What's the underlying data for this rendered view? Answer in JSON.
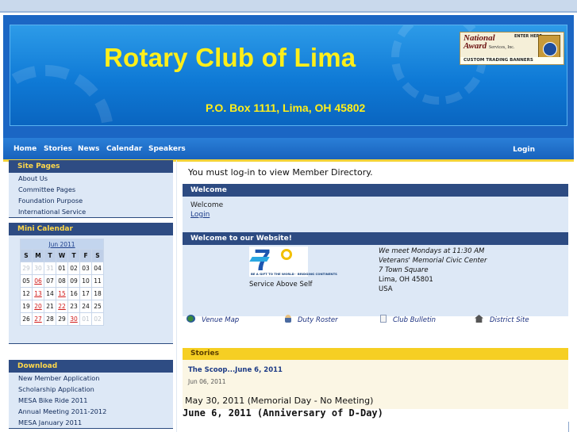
{
  "header": {
    "title": "Rotary Club of Lima",
    "address": "P.O. Box 1111, Lima, OH 45802",
    "ad": {
      "brand_line1": "National",
      "brand_line2": "Award",
      "brand_small": "Services, Inc.",
      "enter_here": "ENTER HERE",
      "footer": "CUSTOM TRADING BANNERS"
    }
  },
  "nav": {
    "items": [
      "Home",
      "Stories",
      "News",
      "Calendar",
      "Speakers"
    ],
    "login": "Login"
  },
  "sidebar": {
    "site_pages": {
      "title": "Site Pages",
      "items": [
        "About Us",
        "Committee Pages",
        "Foundation Purpose",
        "International Service"
      ]
    },
    "mini_calendar": {
      "title": "Mini Calendar",
      "month": "Jun 2011",
      "weekdays": [
        "S",
        "M",
        "T",
        "W",
        "T",
        "F",
        "S"
      ],
      "weeks": [
        [
          "29",
          "30",
          "31",
          "01",
          "02",
          "03",
          "04"
        ],
        [
          "05",
          "06",
          "07",
          "08",
          "09",
          "10",
          "11"
        ],
        [
          "12",
          "13",
          "14",
          "15",
          "16",
          "17",
          "18"
        ],
        [
          "19",
          "20",
          "21",
          "22",
          "23",
          "24",
          "25"
        ],
        [
          "26",
          "27",
          "28",
          "29",
          "30",
          "01",
          "02"
        ]
      ],
      "event_days": [
        "06",
        "13",
        "15",
        "20",
        "22",
        "27",
        "30"
      ]
    },
    "download": {
      "title": "Download",
      "items": [
        "New Member Application",
        "Scholarship Application",
        "MESA Bike Ride 2011",
        "Annual Meeting 2011-2012",
        "MESA January 2011"
      ]
    }
  },
  "main": {
    "login_message": "You must log-in to view Member Directory.",
    "welcome": {
      "title": "Welcome",
      "text": "Welcome",
      "login_link": "Login"
    },
    "site": {
      "title": "Welcome to our Website!",
      "logo_tagline": "BE A GIFT TO THE WORLD · BRIDGING CONTINENTS",
      "motto": "Service Above Self",
      "meeting": [
        "We meet Mondays at 11:30 AM",
        "Veterans' Memorial Civic Center",
        "7 Town Square",
        "Lima, OH 45801",
        "USA"
      ],
      "links": [
        {
          "label": "Venue Map",
          "icon": "map-icon"
        },
        {
          "label": "Duty Roster",
          "icon": "person-icon"
        },
        {
          "label": "Club Bulletin",
          "icon": "document-icon"
        },
        {
          "label": "District Site",
          "icon": "house-icon"
        }
      ]
    },
    "stories": {
      "title": "Stories",
      "story_title": "The Scoop...June 6, 2011",
      "story_date": "Jun 06, 2011",
      "line1": "May 30, 2011 (Memorial Day - No Meeting)",
      "line2": "June 6, 2011 (Anniversary of D-Day)"
    }
  }
}
